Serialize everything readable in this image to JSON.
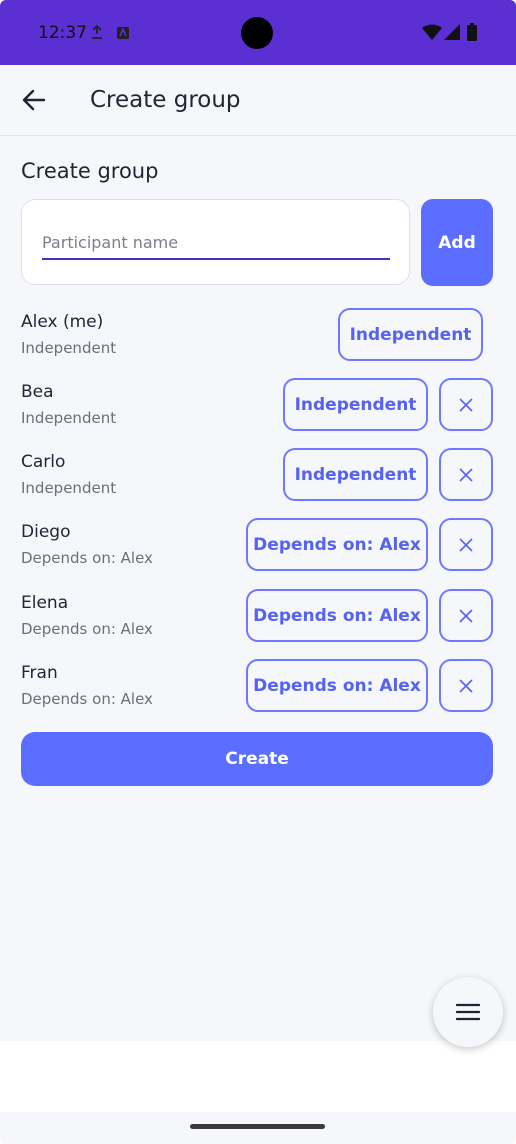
{
  "status": {
    "time": "12:37"
  },
  "app_bar": {
    "title": "Create group"
  },
  "form": {
    "section_title": "Create group",
    "input_placeholder": "Participant name",
    "input_value": "",
    "add_label": "Add"
  },
  "participants": [
    {
      "name": "Alex (me)",
      "status": "Independent",
      "button": "Independent",
      "removable": false
    },
    {
      "name": "Bea",
      "status": "Independent",
      "button": "Independent",
      "removable": true
    },
    {
      "name": "Carlo",
      "status": "Independent",
      "button": "Independent",
      "removable": true
    },
    {
      "name": "Diego",
      "status": "Depends on: Alex",
      "button": "Depends on: Alex",
      "removable": true
    },
    {
      "name": "Elena",
      "status": "Depends on: Alex",
      "button": "Depends on: Alex",
      "removable": true
    },
    {
      "name": "Fran",
      "status": "Depends on: Alex",
      "button": "Depends on: Alex",
      "removable": true
    }
  ],
  "create_label": "Create",
  "icons": {
    "back": "arrow-back-icon",
    "remove": "close-icon",
    "fab": "menu-icon"
  },
  "colors": {
    "status_bar": "#5b2fd1",
    "accent": "#5c6eff",
    "outline": "#6e79ff",
    "background": "#f6f7fb"
  }
}
